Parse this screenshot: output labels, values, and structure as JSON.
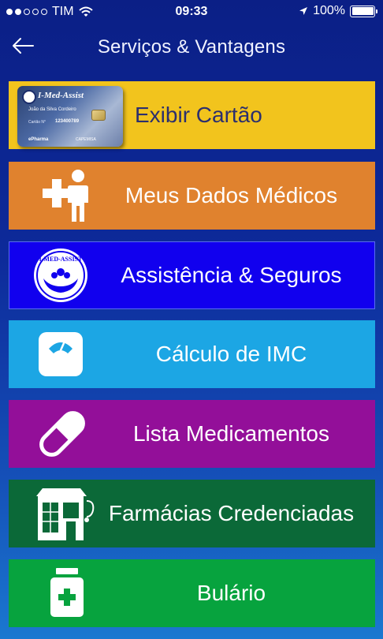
{
  "status": {
    "carrier": "TIM",
    "time": "09:33",
    "battery": "100%",
    "signal_bars_filled": 2,
    "signal_bars_total": 5
  },
  "nav": {
    "title": "Serviços & Vantagens",
    "back_icon": "arrow-left-icon"
  },
  "card": {
    "brand": "I-Med-Assist",
    "holder": "João da Silva Cordeiro",
    "number_label": "Cartão N°",
    "number": "123400789",
    "partner_left": "ePharma",
    "partner_right": "CAPEMISA"
  },
  "menu": [
    {
      "label": "Exibir Cartão",
      "icon": "card-image",
      "color": "#f2c41d"
    },
    {
      "label": "Meus Dados Médicos",
      "icon": "medical-person-icon",
      "color": "#e0822e"
    },
    {
      "label": "Assistência & Seguros",
      "icon": "i-med-assist-logo-icon",
      "color": "#1100ee"
    },
    {
      "label": "Cálculo de IMC",
      "icon": "scale-icon",
      "color": "#1ca6e4"
    },
    {
      "label": "Lista Medicamentos",
      "icon": "pill-icon",
      "color": "#930f99"
    },
    {
      "label": "Farmácias Credenciadas",
      "icon": "pharmacy-building-icon",
      "color": "#0b6938"
    },
    {
      "label": "Bulário",
      "icon": "medicine-bottle-icon",
      "color": "#07a33e"
    }
  ]
}
